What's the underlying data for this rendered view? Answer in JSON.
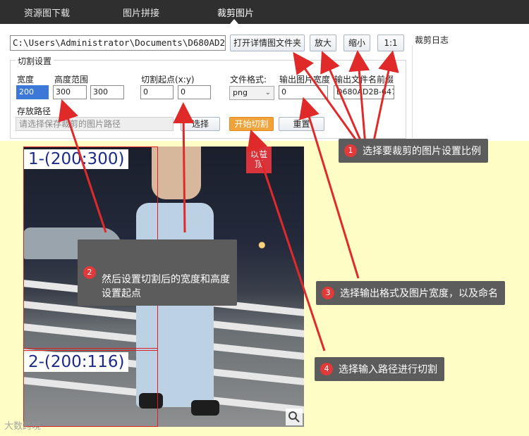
{
  "nav": {
    "tabs": [
      "资源图下载",
      "图片拼接",
      "裁剪图片"
    ],
    "active_index": 2
  },
  "toolbar": {
    "path_value": "C:\\Users\\Administrator\\Documents\\D680AD2",
    "open_folder_label": "打开详情图文件夹",
    "zoom_in_label": "放大",
    "zoom_out_label": "缩小",
    "ratio_label": "1:1"
  },
  "settings": {
    "group_title": "切割设置",
    "width_label": "宽度",
    "width_value": "200",
    "height_range_label": "高度范围",
    "height_min_value": "300",
    "height_max_value": "300",
    "start_label": "切割起点(x:y)",
    "start_x_value": "0",
    "start_y_value": "0",
    "format_label": "文件格式:",
    "format_value": "png",
    "out_width_label": "输出图片宽度",
    "out_width_value": "0",
    "prefix_label": "输出文件名前缀",
    "prefix_value": "D680AD2B-6475-",
    "store_label": "存放路径",
    "store_placeholder": "请选择保存裁剪的图片路径",
    "choose_label": "选择",
    "start_cut_label": "开始切割",
    "reset_label": "重置"
  },
  "log": {
    "title": "裁剪日志"
  },
  "preview": {
    "crop1_label": "1-(200:300)",
    "crop2_label": "2-(200:116)",
    "badge_text": "以益\n顶"
  },
  "callouts": [
    {
      "num": "1",
      "text": "选择要裁剪的图片设置比例"
    },
    {
      "num": "2",
      "text": "然后设置切割后的宽度和高度\n设置起点"
    },
    {
      "num": "3",
      "text": "选择输出格式及图片宽度，以及命名"
    },
    {
      "num": "4",
      "text": "选择输入路径进行切割"
    }
  ],
  "watermark": "大数跨境",
  "colors": {
    "nav_bg": "#2f2f2f",
    "accent_orange": "#f0a33a",
    "highlight_yellow": "#fffdc6",
    "crop_red": "#e02020",
    "callout_bg": "#5c5c5c",
    "callout_num": "#e03a3a"
  }
}
